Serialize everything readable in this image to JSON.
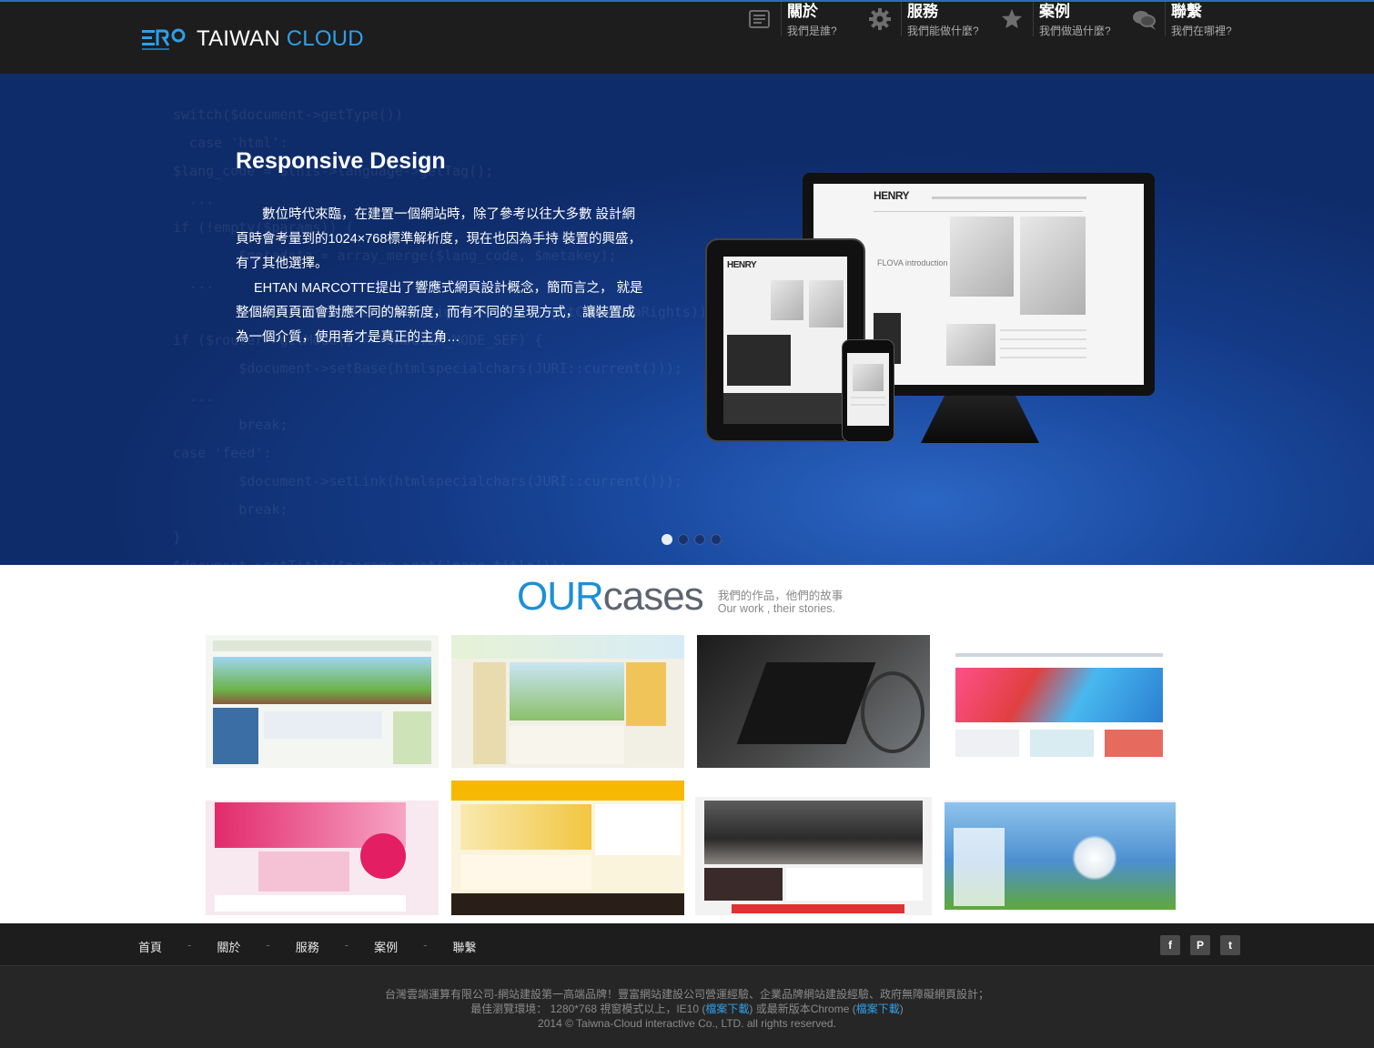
{
  "header": {
    "logo_word_white": "TAIWAN",
    "logo_word_blue": "CLOUD",
    "nav": [
      {
        "title": "關於",
        "sub": "我們是誰?",
        "icon": "document-icon"
      },
      {
        "title": "服務",
        "sub": "我們能做什麼?",
        "icon": "gear-icon"
      },
      {
        "title": "案例",
        "sub": "我們做過什麼?",
        "icon": "star-icon"
      },
      {
        "title": "聯繫",
        "sub": "我們在哪裡?",
        "icon": "chat-icon"
      }
    ]
  },
  "hero": {
    "title": "Responsive Design",
    "paragraph1": "數位時代來臨，在建置一個網站時，除了參考以往大多數 設計網頁時會考量到的1024×768標準解析度，現在也因為手持 裝置的興盛，有了其他選擇。",
    "paragraph2": "EHTAN MARCOTTE提出了響應式網頁設計概念，簡而言之， 就是整個網頁頁面會對應不同的解新度，而有不同的呈現方式， 讓裝置成為一個介質，使用者才是真正的主角…",
    "slides": 4,
    "active_slide": 1,
    "device_brand": "HENRY",
    "device_label": "FLOVA introduction"
  },
  "cases": {
    "title_our": "OUR",
    "title_cases": "cases",
    "sub_zh": "我們的作品，他們的故事",
    "sub_en": "Our work , their stories."
  },
  "footer": {
    "links": [
      "首頁",
      "關於",
      "服務",
      "案例",
      "聯繫"
    ],
    "social": [
      "f",
      "P",
      "t"
    ],
    "line1": "台灣雲端運算有限公司-網站建設第一高端品牌！豐富網站建設公司營運經驗、企業品牌網站建設經驗、政府無障礙網頁設計；",
    "line2_pre": "最佳瀏覽環境： 1280*768 視窗模式以上，IE10 (",
    "line2_link1": "檔案下載",
    "line2_mid": ") 或最新版本Chrome (",
    "line2_link2": "檔案下載",
    "line2_post": ")",
    "line3": "2014 © Taiwna-Cloud interactive Co., LTD. all rights reserved."
  },
  "colors": {
    "accent": "#2f9fe8",
    "header_bg": "#1d1d1d",
    "hero_blue": "#1a4aa0"
  }
}
